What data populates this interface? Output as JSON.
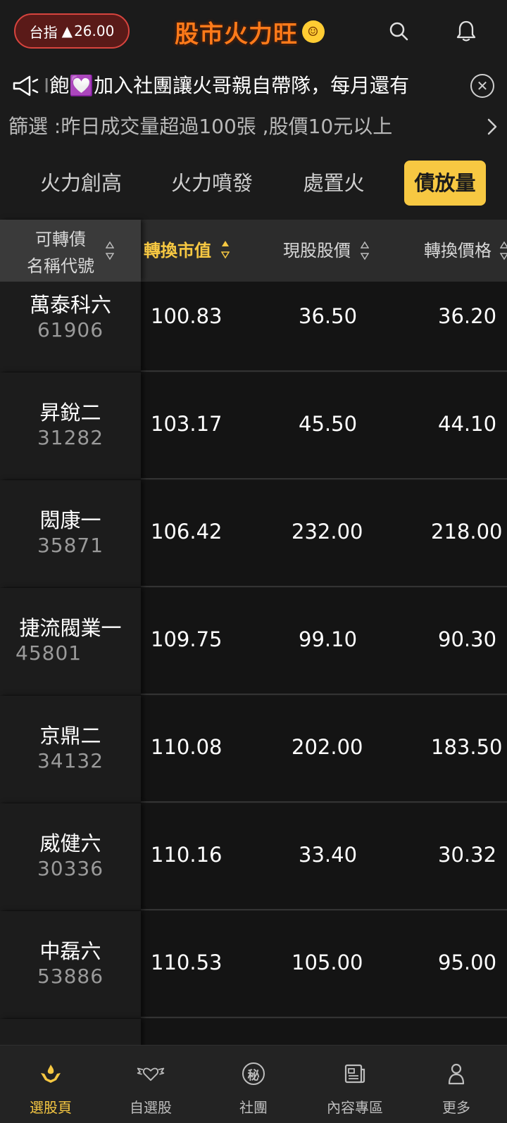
{
  "header": {
    "index_label": "台指",
    "index_value": "26.00",
    "brand": "股市火力旺",
    "icons": {
      "search": "search-icon",
      "bell": "bell-icon"
    }
  },
  "marquee": {
    "text": "飽💟加入社團讓火哥親自帶隊，每月還有",
    "prefix": "I"
  },
  "filter": {
    "text": "篩選 :昨日成交量超過100張 ,股價10元以上"
  },
  "tabs": [
    {
      "label": "火力創高",
      "active": false
    },
    {
      "label": "火力噴發",
      "active": false
    },
    {
      "label": "處置火",
      "active": false
    },
    {
      "label": "債放量",
      "active": true
    }
  ],
  "table": {
    "name_header_line1": "可轉債",
    "name_header_line2": "名稱代號",
    "columns": [
      "轉換市值",
      "現股股價",
      "轉換價格"
    ],
    "rows": [
      {
        "name": "萬泰科六",
        "code": "61906",
        "value": "100.83",
        "price": "36.50",
        "conv": "36.20"
      },
      {
        "name": "昇銳二",
        "code": "31282",
        "value": "103.17",
        "price": "45.50",
        "conv": "44.10"
      },
      {
        "name": "閎康一",
        "code": "35871",
        "value": "106.42",
        "price": "232.00",
        "conv": "218.00"
      },
      {
        "name": "捷流閥業一",
        "code": "45801",
        "value": "109.75",
        "price": "99.10",
        "conv": "90.30"
      },
      {
        "name": "京鼎二",
        "code": "34132",
        "value": "110.08",
        "price": "202.00",
        "conv": "183.50"
      },
      {
        "name": "威健六",
        "code": "30336",
        "value": "110.16",
        "price": "33.40",
        "conv": "30.32"
      },
      {
        "name": "中磊六",
        "code": "53886",
        "value": "110.53",
        "price": "105.00",
        "conv": "95.00"
      }
    ]
  },
  "bottom_nav": [
    {
      "label": "選股頁",
      "icon": "hands-flame-icon",
      "active": true
    },
    {
      "label": "自選股",
      "icon": "winged-heart-icon",
      "active": false
    },
    {
      "label": "社團",
      "icon": "secret-badge-icon",
      "icon_text": "秘",
      "active": false
    },
    {
      "label": "內容專區",
      "icon": "newspaper-icon",
      "active": false
    },
    {
      "label": "更多",
      "icon": "person-icon",
      "active": false
    }
  ],
  "colors": {
    "accent": "#f7c842",
    "badge_red": "#d7443e",
    "bg": "#1a1a1a"
  }
}
